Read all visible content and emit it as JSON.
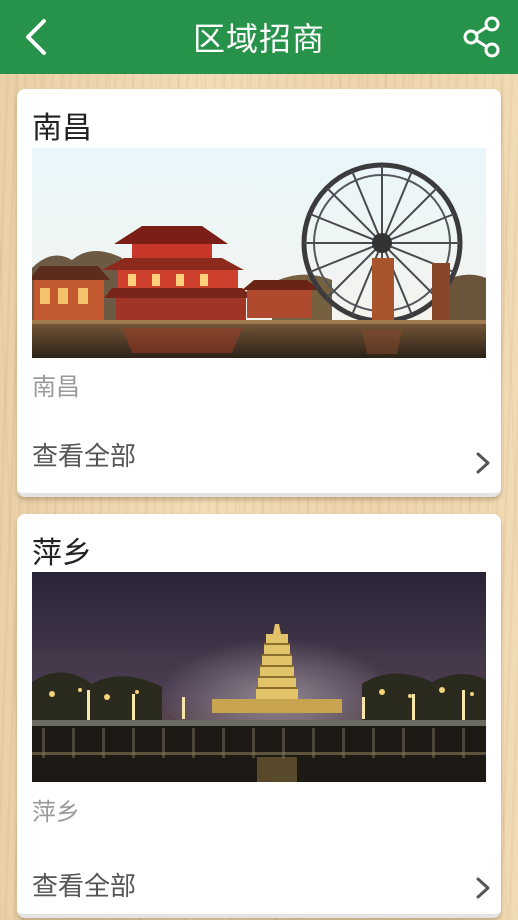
{
  "header": {
    "title": "区域招商",
    "back_icon": "chevron-left-icon",
    "share_icon": "share-icon",
    "color": "#27924a"
  },
  "regions": [
    {
      "title": "南昌",
      "caption": "南昌",
      "more_label": "查看全部",
      "image": "pavilion-waterwheel-scene"
    },
    {
      "title": "萍乡",
      "caption": "萍乡",
      "more_label": "查看全部",
      "image": "night-pagoda-scene"
    }
  ]
}
